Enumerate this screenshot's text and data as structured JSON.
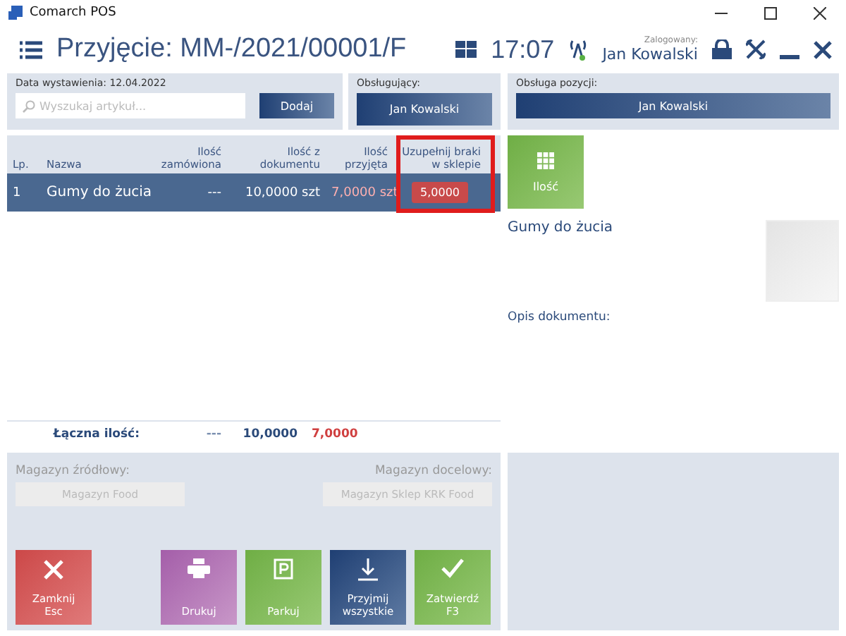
{
  "window": {
    "title": "Comarch POS"
  },
  "header": {
    "title": "Przyjęcie: MM-/2021/00001/F",
    "time": "17:07",
    "logged_label": "Zalogowany:",
    "user": "Jan Kowalski"
  },
  "search_panel": {
    "date_label": "Data wystawienia: 12.04.2022",
    "placeholder": "Wyszukaj artykuł...",
    "add_button": "Dodaj"
  },
  "operator_panel": {
    "label": "Obsługujący:",
    "value": "Jan Kowalski"
  },
  "position_panel": {
    "label": "Obsługa pozycji:",
    "value": "Jan Kowalski"
  },
  "table": {
    "columns": [
      "Lp.",
      "Nazwa",
      "Ilość zamówiona",
      "Ilość z dokumentu",
      "Ilość przyjęta",
      "Uzupełnij braki w sklepie"
    ],
    "rows": [
      {
        "cells": [
          "1",
          "Gumy do żucia",
          "---",
          "10,0000 szt",
          "7,0000 szt",
          "5,0000"
        ],
        "selected": true
      }
    ],
    "totals": {
      "label": "Łączna ilość:",
      "ordered": "---",
      "document": "10,0000",
      "received": "7,0000"
    }
  },
  "warehouses": {
    "source_label": "Magazyn źródłowy:",
    "source": "Magazyn Food",
    "target_label": "Magazyn docelowy:",
    "target": "Magazyn Sklep KRK Food"
  },
  "actions": [
    {
      "kind": "close",
      "label": "Zamknij",
      "shortcut": "Esc"
    },
    {
      "kind": "print",
      "label": "Drukuj"
    },
    {
      "kind": "park",
      "label": "Parkuj"
    },
    {
      "kind": "accept",
      "label": "Przyjmij wszystkie"
    },
    {
      "kind": "confirm",
      "label": "Zatwierdź",
      "shortcut": "F3"
    }
  ],
  "details": {
    "quantity_button": "Ilość",
    "product_name": "Gumy do żucia",
    "description_label": "Opis dokumentu:"
  }
}
